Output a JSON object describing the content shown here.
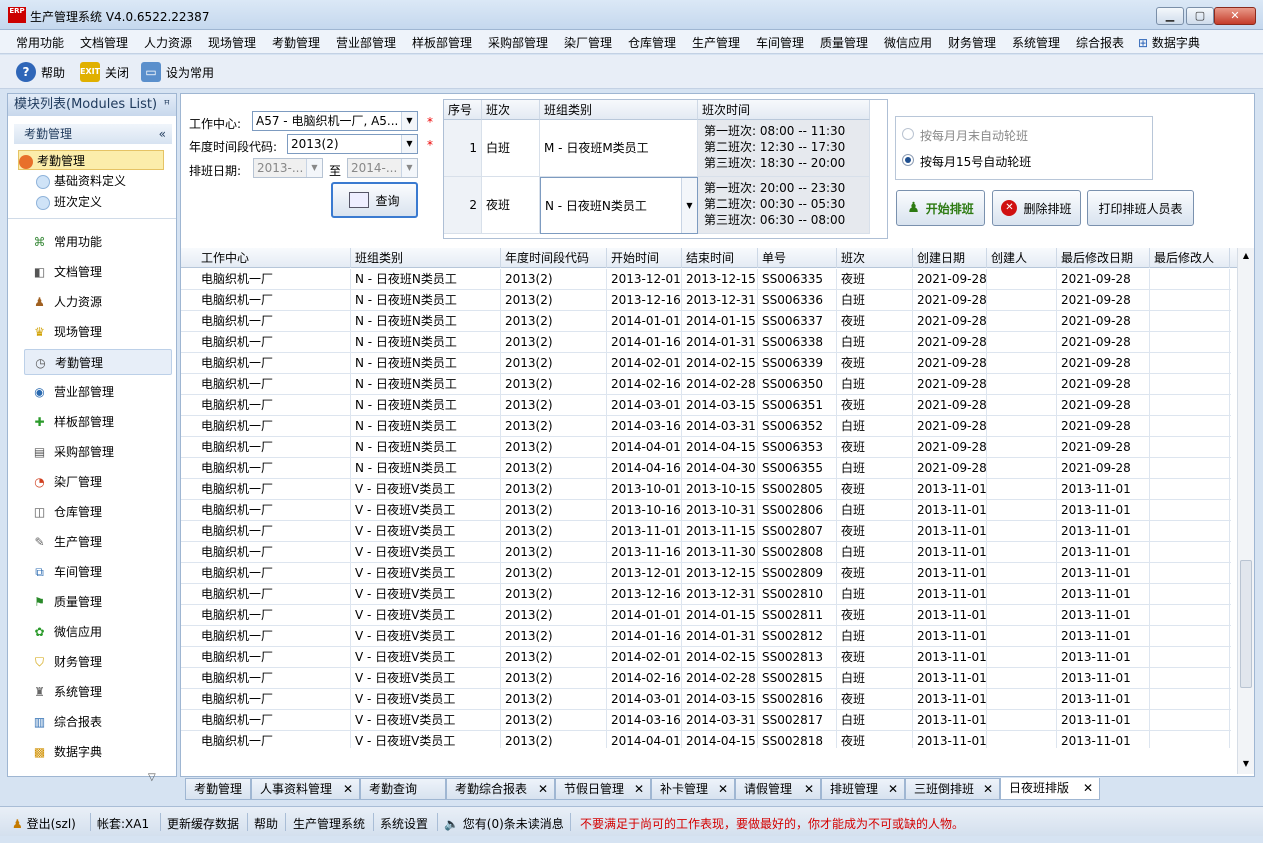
{
  "window": {
    "title": "生产管理系统 V4.0.6522.22387",
    "logo": "ERP",
    "min": "▁",
    "max": "▢",
    "close": "✕"
  },
  "menu": [
    "常用功能",
    "文档管理",
    "人力资源",
    "现场管理",
    "考勤管理",
    "营业部管理",
    "样板部管理",
    "采购部管理",
    "染厂管理",
    "仓库管理",
    "生产管理",
    "车间管理",
    "质量管理",
    "微信应用",
    "财务管理",
    "系统管理",
    "综合报表",
    "数据字典"
  ],
  "toolbar": {
    "help": "帮助",
    "close": "关闭",
    "set_common": "设为常用"
  },
  "sidebar": {
    "header": "模块列表(Modules List)",
    "pin": "ꟸ",
    "group": "考勤管理",
    "group_collapse": "«",
    "tree": [
      "考勤管理",
      "基础资料定义",
      "班次定义"
    ],
    "modules": [
      "常用功能",
      "文档管理",
      "人力资源",
      "现场管理",
      "考勤管理",
      "营业部管理",
      "样板部管理",
      "采购部管理",
      "染厂管理",
      "仓库管理",
      "生产管理",
      "车间管理",
      "质量管理",
      "微信应用",
      "财务管理",
      "系统管理",
      "综合报表",
      "数据字典"
    ],
    "scroll_down": "▽"
  },
  "form": {
    "work_center_label": "工作中心:",
    "work_center_value": "A57 - 电脑织机一厂, A5...",
    "period_label": "年度时间段代码:",
    "period_value": "2013(2)",
    "date_label": "排班日期:",
    "date_from": "2013-...",
    "date_to_label": "至",
    "date_to": "2014-...",
    "query_button": "查询",
    "required": "*"
  },
  "shift_table": {
    "headers": [
      "序号",
      "班次",
      "班组类别",
      "班次时间"
    ],
    "rows": [
      {
        "no": "1",
        "shift": "白班",
        "group": "M - 日夜班M类员工",
        "times": [
          "第一班次: 08:00 -- 11:30",
          "第二班次: 12:30 -- 17:30",
          "第三班次: 18:30 -- 20:00"
        ]
      },
      {
        "no": "2",
        "shift": "夜班",
        "group": "N - 日夜班N类员工",
        "times": [
          "第一班次: 20:00 -- 23:30",
          "第二班次: 00:30 -- 05:30",
          "第三班次: 06:30 -- 08:00"
        ]
      }
    ]
  },
  "rotation": {
    "option1": "按每月月末自动轮班",
    "option2": "按每月15号自动轮班"
  },
  "actions": {
    "start": "开始排班",
    "delete": "删除排班",
    "print": "打印排班人员表"
  },
  "grid": {
    "headers": [
      "工作中心",
      "班组类别",
      "年度时间段代码",
      "开始时间",
      "结束时间",
      "单号",
      "班次",
      "创建日期",
      "创建人",
      "最后修改日期",
      "最后修改人"
    ],
    "rows": [
      [
        "电脑织机一厂",
        "N - 日夜班N类员工",
        "2013(2)",
        "2013-12-01",
        "2013-12-15",
        "SS006335",
        "夜班",
        "2021-09-28",
        "",
        "2021-09-28",
        ""
      ],
      [
        "电脑织机一厂",
        "N - 日夜班N类员工",
        "2013(2)",
        "2013-12-16",
        "2013-12-31",
        "SS006336",
        "白班",
        "2021-09-28",
        "",
        "2021-09-28",
        ""
      ],
      [
        "电脑织机一厂",
        "N - 日夜班N类员工",
        "2013(2)",
        "2014-01-01",
        "2014-01-15",
        "SS006337",
        "夜班",
        "2021-09-28",
        "",
        "2021-09-28",
        ""
      ],
      [
        "电脑织机一厂",
        "N - 日夜班N类员工",
        "2013(2)",
        "2014-01-16",
        "2014-01-31",
        "SS006338",
        "白班",
        "2021-09-28",
        "",
        "2021-09-28",
        ""
      ],
      [
        "电脑织机一厂",
        "N - 日夜班N类员工",
        "2013(2)",
        "2014-02-01",
        "2014-02-15",
        "SS006339",
        "夜班",
        "2021-09-28",
        "",
        "2021-09-28",
        ""
      ],
      [
        "电脑织机一厂",
        "N - 日夜班N类员工",
        "2013(2)",
        "2014-02-16",
        "2014-02-28",
        "SS006350",
        "白班",
        "2021-09-28",
        "",
        "2021-09-28",
        ""
      ],
      [
        "电脑织机一厂",
        "N - 日夜班N类员工",
        "2013(2)",
        "2014-03-01",
        "2014-03-15",
        "SS006351",
        "夜班",
        "2021-09-28",
        "",
        "2021-09-28",
        ""
      ],
      [
        "电脑织机一厂",
        "N - 日夜班N类员工",
        "2013(2)",
        "2014-03-16",
        "2014-03-31",
        "SS006352",
        "白班",
        "2021-09-28",
        "",
        "2021-09-28",
        ""
      ],
      [
        "电脑织机一厂",
        "N - 日夜班N类员工",
        "2013(2)",
        "2014-04-01",
        "2014-04-15",
        "SS006353",
        "夜班",
        "2021-09-28",
        "",
        "2021-09-28",
        ""
      ],
      [
        "电脑织机一厂",
        "N - 日夜班N类员工",
        "2013(2)",
        "2014-04-16",
        "2014-04-30",
        "SS006355",
        "白班",
        "2021-09-28",
        "",
        "2021-09-28",
        ""
      ],
      [
        "电脑织机一厂",
        "V - 日夜班V类员工",
        "2013(2)",
        "2013-10-01",
        "2013-10-15",
        "SS002805",
        "夜班",
        "2013-11-01",
        "",
        "2013-11-01",
        ""
      ],
      [
        "电脑织机一厂",
        "V - 日夜班V类员工",
        "2013(2)",
        "2013-10-16",
        "2013-10-31",
        "SS002806",
        "白班",
        "2013-11-01",
        "",
        "2013-11-01",
        ""
      ],
      [
        "电脑织机一厂",
        "V - 日夜班V类员工",
        "2013(2)",
        "2013-11-01",
        "2013-11-15",
        "SS002807",
        "夜班",
        "2013-11-01",
        "",
        "2013-11-01",
        ""
      ],
      [
        "电脑织机一厂",
        "V - 日夜班V类员工",
        "2013(2)",
        "2013-11-16",
        "2013-11-30",
        "SS002808",
        "白班",
        "2013-11-01",
        "",
        "2013-11-01",
        ""
      ],
      [
        "电脑织机一厂",
        "V - 日夜班V类员工",
        "2013(2)",
        "2013-12-01",
        "2013-12-15",
        "SS002809",
        "夜班",
        "2013-11-01",
        "",
        "2013-11-01",
        ""
      ],
      [
        "电脑织机一厂",
        "V - 日夜班V类员工",
        "2013(2)",
        "2013-12-16",
        "2013-12-31",
        "SS002810",
        "白班",
        "2013-11-01",
        "",
        "2013-11-01",
        ""
      ],
      [
        "电脑织机一厂",
        "V - 日夜班V类员工",
        "2013(2)",
        "2014-01-01",
        "2014-01-15",
        "SS002811",
        "夜班",
        "2013-11-01",
        "",
        "2013-11-01",
        ""
      ],
      [
        "电脑织机一厂",
        "V - 日夜班V类员工",
        "2013(2)",
        "2014-01-16",
        "2014-01-31",
        "SS002812",
        "白班",
        "2013-11-01",
        "",
        "2013-11-01",
        ""
      ],
      [
        "电脑织机一厂",
        "V - 日夜班V类员工",
        "2013(2)",
        "2014-02-01",
        "2014-02-15",
        "SS002813",
        "夜班",
        "2013-11-01",
        "",
        "2013-11-01",
        ""
      ],
      [
        "电脑织机一厂",
        "V - 日夜班V类员工",
        "2013(2)",
        "2014-02-16",
        "2014-02-28",
        "SS002815",
        "白班",
        "2013-11-01",
        "",
        "2013-11-01",
        ""
      ],
      [
        "电脑织机一厂",
        "V - 日夜班V类员工",
        "2013(2)",
        "2014-03-01",
        "2014-03-15",
        "SS002816",
        "夜班",
        "2013-11-01",
        "",
        "2013-11-01",
        ""
      ],
      [
        "电脑织机一厂",
        "V - 日夜班V类员工",
        "2013(2)",
        "2014-03-16",
        "2014-03-31",
        "SS002817",
        "白班",
        "2013-11-01",
        "",
        "2013-11-01",
        ""
      ],
      [
        "电脑织机一厂",
        "V - 日夜班V类员工",
        "2013(2)",
        "2014-04-01",
        "2014-04-15",
        "SS002818",
        "夜班",
        "2013-11-01",
        "",
        "2013-11-01",
        ""
      ]
    ]
  },
  "tabs": [
    {
      "label": "考勤管理",
      "closable": false
    },
    {
      "label": "人事资料管理",
      "closable": true
    },
    {
      "label": "考勤查询",
      "closable": false
    },
    {
      "label": "考勤综合报表",
      "closable": true
    },
    {
      "label": "节假日管理",
      "closable": true
    },
    {
      "label": "补卡管理",
      "closable": true
    },
    {
      "label": "请假管理",
      "closable": true
    },
    {
      "label": "排班管理",
      "closable": true
    },
    {
      "label": "三班倒排班",
      "closable": true
    },
    {
      "label": "日夜班排版",
      "closable": true,
      "active": true
    }
  ],
  "tab_close": "✕",
  "status": {
    "logout": "登出(szl)",
    "account": "帐套:XA1",
    "refresh_cache": "更新缓存数据",
    "help": "帮助",
    "system": "生产管理系统",
    "settings": "系统设置",
    "messages": "您有(0)条未读消息",
    "motto": "不要满足于尚可的工作表现，要做最好的，你才能成为不可或缺的人物。"
  },
  "colors": {
    "accent": "#1e395b",
    "motto": "#d40000",
    "start": "#2d7a12",
    "delete": "#d01010"
  }
}
